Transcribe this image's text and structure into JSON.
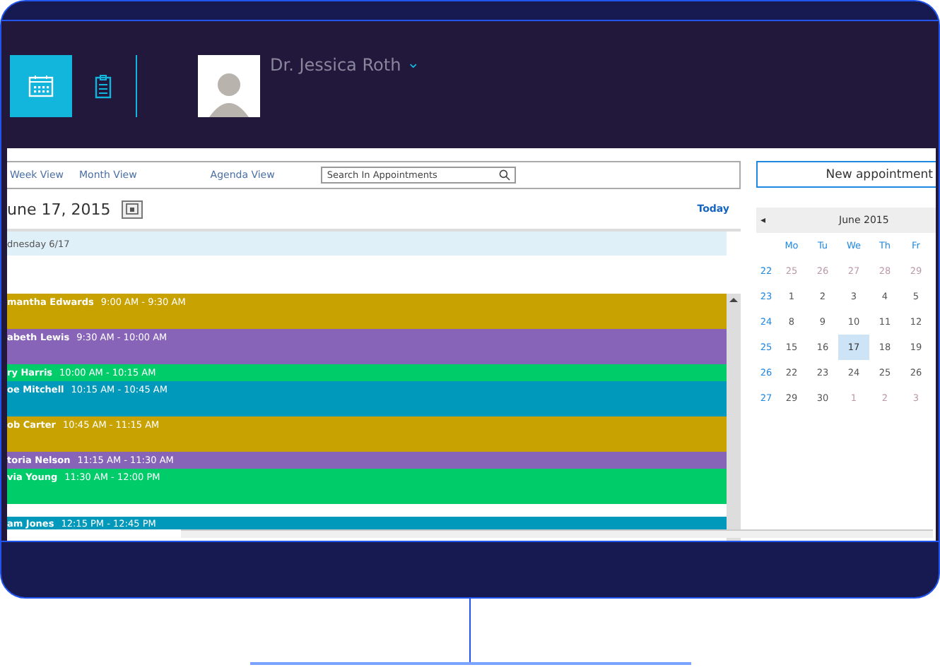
{
  "header": {
    "nav": [
      {
        "kind": "calendar",
        "selected": true
      },
      {
        "kind": "clipboard",
        "selected": false
      }
    ],
    "user": {
      "name": "Dr. Jessica Roth",
      "chevron": "⌄"
    }
  },
  "toolbar": {
    "views": [
      {
        "label": "Week View"
      },
      {
        "label": "Month View"
      },
      {
        "label": "Agenda View"
      }
    ],
    "search": {
      "placeholder": "Search In Appointments"
    }
  },
  "date_bar": {
    "date": "une 17, 2015",
    "today": "Today"
  },
  "day_header": "dnesday 6/17",
  "appointments": [
    {
      "kind": "long",
      "name": "mantha Edwards",
      "time": "9:00 AM - 9:30 AM",
      "color": "#c8a200"
    },
    {
      "kind": "long",
      "name": "abeth Lewis",
      "time": "9:30 AM - 10:00 AM",
      "color": "#8764b8"
    },
    {
      "kind": "short",
      "name": "ry Harris",
      "time": "10:00 AM - 10:15 AM",
      "color": "#00cc6a"
    },
    {
      "kind": "long",
      "name": "oe Mitchell",
      "time": "10:15 AM - 10:45 AM",
      "color": "#0099bc"
    },
    {
      "kind": "long",
      "name": "ob Carter",
      "time": "10:45 AM - 11:15 AM",
      "color": "#c8a200"
    },
    {
      "kind": "short",
      "name": "toria Nelson",
      "time": "11:15 AM - 11:30 AM",
      "color": "#8764b8"
    },
    {
      "kind": "long",
      "name": "via Young",
      "time": "11:30 AM - 12:00 PM",
      "color": "#00cc6a"
    },
    {
      "kind": "gap"
    },
    {
      "kind": "cut",
      "name": "am Jones",
      "time": "12:15 PM - 12:45 PM",
      "color": "#0099bc"
    }
  ],
  "new_appointment": "New appointment",
  "mini_calendar": {
    "prev": "◂",
    "month": "June 2015",
    "weekdays": [
      "Mo",
      "Tu",
      "We",
      "Th",
      "Fr"
    ],
    "weeks": [
      {
        "number": "22",
        "days": [
          {
            "label": "25",
            "other_month": true,
            "selected": false
          },
          {
            "label": "26",
            "other_month": true,
            "selected": false
          },
          {
            "label": "27",
            "other_month": true,
            "selected": false
          },
          {
            "label": "28",
            "other_month": true,
            "selected": false
          },
          {
            "label": "29",
            "other_month": true,
            "selected": false
          }
        ]
      },
      {
        "number": "23",
        "days": [
          {
            "label": "1",
            "other_month": false,
            "selected": false
          },
          {
            "label": "2",
            "other_month": false,
            "selected": false
          },
          {
            "label": "3",
            "other_month": false,
            "selected": false
          },
          {
            "label": "4",
            "other_month": false,
            "selected": false
          },
          {
            "label": "5",
            "other_month": false,
            "selected": false
          }
        ]
      },
      {
        "number": "24",
        "days": [
          {
            "label": "8",
            "other_month": false,
            "selected": false
          },
          {
            "label": "9",
            "other_month": false,
            "selected": false
          },
          {
            "label": "10",
            "other_month": false,
            "selected": false
          },
          {
            "label": "11",
            "other_month": false,
            "selected": false
          },
          {
            "label": "12",
            "other_month": false,
            "selected": false
          }
        ]
      },
      {
        "number": "25",
        "days": [
          {
            "label": "15",
            "other_month": false,
            "selected": false
          },
          {
            "label": "16",
            "other_month": false,
            "selected": false
          },
          {
            "label": "17",
            "other_month": false,
            "selected": true
          },
          {
            "label": "18",
            "other_month": false,
            "selected": false
          },
          {
            "label": "19",
            "other_month": false,
            "selected": false
          }
        ]
      },
      {
        "number": "26",
        "days": [
          {
            "label": "22",
            "other_month": false,
            "selected": false
          },
          {
            "label": "23",
            "other_month": false,
            "selected": false
          },
          {
            "label": "24",
            "other_month": false,
            "selected": false
          },
          {
            "label": "25",
            "other_month": false,
            "selected": false
          },
          {
            "label": "26",
            "other_month": false,
            "selected": false
          }
        ]
      },
      {
        "number": "27",
        "days": [
          {
            "label": "29",
            "other_month": false,
            "selected": false
          },
          {
            "label": "30",
            "other_month": false,
            "selected": false
          },
          {
            "label": "1",
            "other_month": true,
            "selected": false
          },
          {
            "label": "2",
            "other_month": true,
            "selected": false
          },
          {
            "label": "3",
            "other_month": true,
            "selected": false
          }
        ]
      }
    ]
  }
}
